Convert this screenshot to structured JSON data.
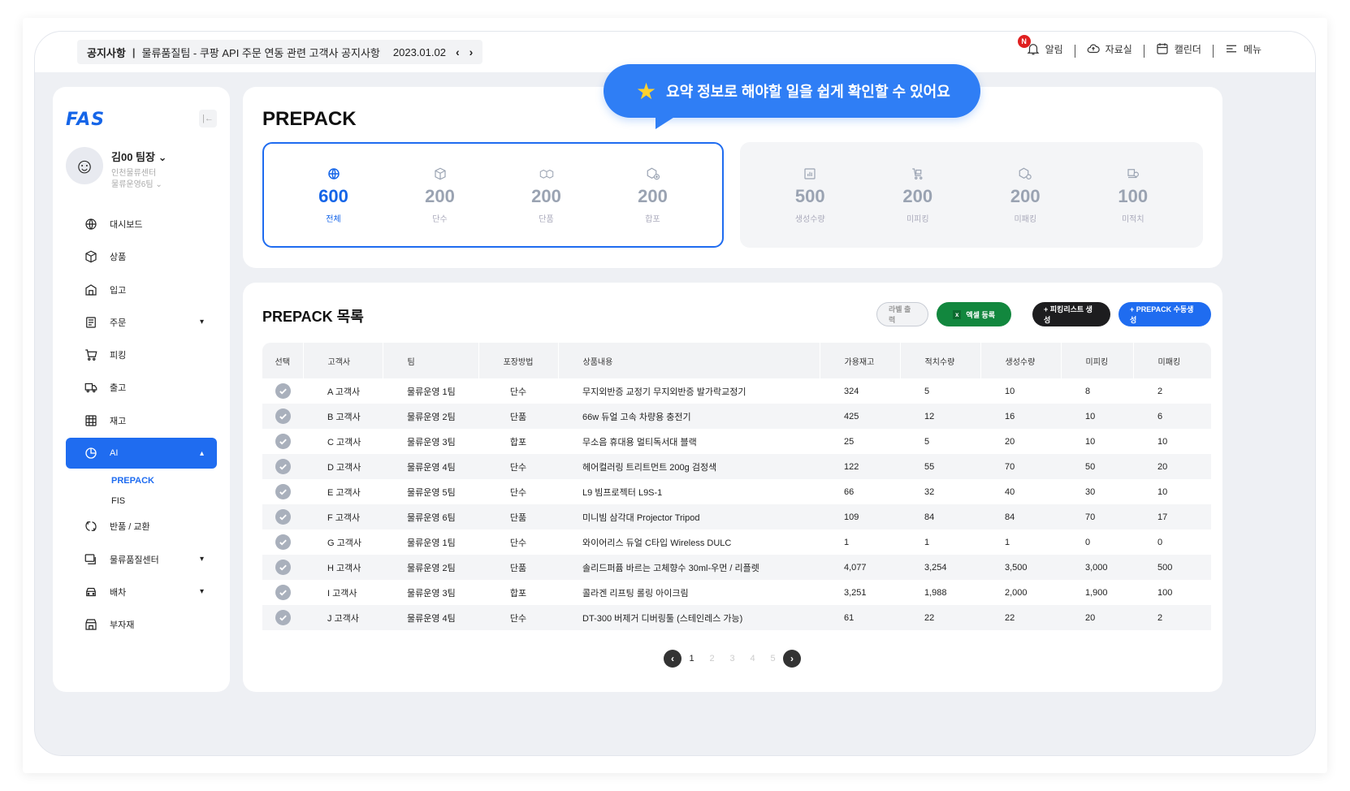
{
  "notice": {
    "label": "공지사항",
    "divider": "|",
    "text": "물류품질팀 - 쿠팡 API 주문 연동 관련 고객사 공지사항",
    "date": "2023.01.02",
    "prev": "‹",
    "next": "›"
  },
  "tools": {
    "badge": "N",
    "alerts": "알림",
    "archive": "자료실",
    "calendar": "캘린더",
    "menu": "메뉴"
  },
  "sidebar": {
    "logo": "FAS",
    "collapse": "|←",
    "user_name": "김00 팀장",
    "user_center": "인천물류센터",
    "user_team": "물류운영6팀",
    "items": [
      {
        "label": "대시보드"
      },
      {
        "label": "상품"
      },
      {
        "label": "입고"
      },
      {
        "label": "주문"
      },
      {
        "label": "피킹"
      },
      {
        "label": "출고"
      },
      {
        "label": "재고"
      },
      {
        "label": "AI"
      },
      {
        "label": "반품 / 교환"
      },
      {
        "label": "물류품질센터"
      },
      {
        "label": "배차"
      },
      {
        "label": "부자재"
      }
    ],
    "ai_sub": [
      "PREPACK",
      "FIS"
    ]
  },
  "summary": {
    "title": "PREPACK",
    "tooltip": "요약 정보로 해야할 일을 쉽게 확인할 수 있어요",
    "group_a": [
      {
        "value": "600",
        "label": "전체",
        "icon": "globe-icon"
      },
      {
        "value": "200",
        "label": "단수",
        "icon": "box-icon"
      },
      {
        "value": "200",
        "label": "단품",
        "icon": "boxes-icon"
      },
      {
        "value": "200",
        "label": "합포",
        "icon": "box-plus-icon"
      }
    ],
    "group_b": [
      {
        "value": "500",
        "label": "생성수량",
        "icon": "chart-icon"
      },
      {
        "value": "200",
        "label": "미피킹",
        "icon": "cart-icon"
      },
      {
        "value": "200",
        "label": "미패킹",
        "icon": "package-icon"
      },
      {
        "value": "100",
        "label": "미적치",
        "icon": "forklift-icon"
      }
    ]
  },
  "list": {
    "title": "PREPACK 목록",
    "buttons": {
      "label_print": "라벨 출력",
      "excel_icon": "x",
      "excel": "엑셀 등록",
      "picking": "+ 피킹리스트 생성",
      "manual": "+ PREPACK 수동생성"
    },
    "columns": [
      "선택",
      "고객사",
      "팀",
      "포장방법",
      "상품내용",
      "가용재고",
      "적치수량",
      "생성수량",
      "미피킹",
      "미패킹"
    ],
    "rows": [
      [
        "A 고객사",
        "물류운영 1팀",
        "단수",
        "무지외반증 교정기 무지외반증 발가락교정기",
        "324",
        "5",
        "10",
        "8",
        "2"
      ],
      [
        "B 고객사",
        "물류운영 2팀",
        "단품",
        "66w 듀얼 고속 차량용 충전기",
        "425",
        "12",
        "16",
        "10",
        "6"
      ],
      [
        "C 고객사",
        "물류운영 3팀",
        "합포",
        "무소음 휴대용 멀티독서대 블랙",
        "25",
        "5",
        "20",
        "10",
        "10"
      ],
      [
        "D 고객사",
        "물류운영 4팀",
        "단수",
        "헤어컬러링 트리트먼트 200g 검정색",
        "122",
        "55",
        "70",
        "50",
        "20"
      ],
      [
        "E 고객사",
        "물류운영 5팀",
        "단수",
        "L9 빔프로젝터 L9S-1",
        "66",
        "32",
        "40",
        "30",
        "10"
      ],
      [
        "F 고객사",
        "물류운영 6팀",
        "단품",
        "미니빔 삼각대 Projector Tripod",
        "109",
        "84",
        "84",
        "70",
        "17"
      ],
      [
        "G 고객사",
        "물류운영 1팀",
        "단수",
        "와이어리스 듀얼 C타입 Wireless DULC",
        "1",
        "1",
        "1",
        "0",
        "0"
      ],
      [
        "H 고객사",
        "물류운영 2팀",
        "단품",
        "솔리드퍼퓸 바르는 고체향수 30ml-우먼 / 리플렛",
        "4,077",
        "3,254",
        "3,500",
        "3,000",
        "500"
      ],
      [
        "I 고객사",
        "물류운영 3팀",
        "합포",
        "콜라겐 리프팅 롤링 아이크림",
        "3,251",
        "1,988",
        "2,000",
        "1,900",
        "100"
      ],
      [
        "J 고객사",
        "물류운영 4팀",
        "단수",
        "DT-300 버제거 디버링툴 (스테인레스 가능)",
        "61",
        "22",
        "22",
        "20",
        "2"
      ]
    ]
  },
  "pager": {
    "prev": "‹",
    "next": "›",
    "pages": [
      "1",
      "2",
      "3",
      "4",
      "5"
    ]
  },
  "colors": {
    "accent": "#1f6cf0",
    "excel": "#12873e",
    "dark": "#1d1d1f",
    "muted": "#9aa3b2"
  }
}
